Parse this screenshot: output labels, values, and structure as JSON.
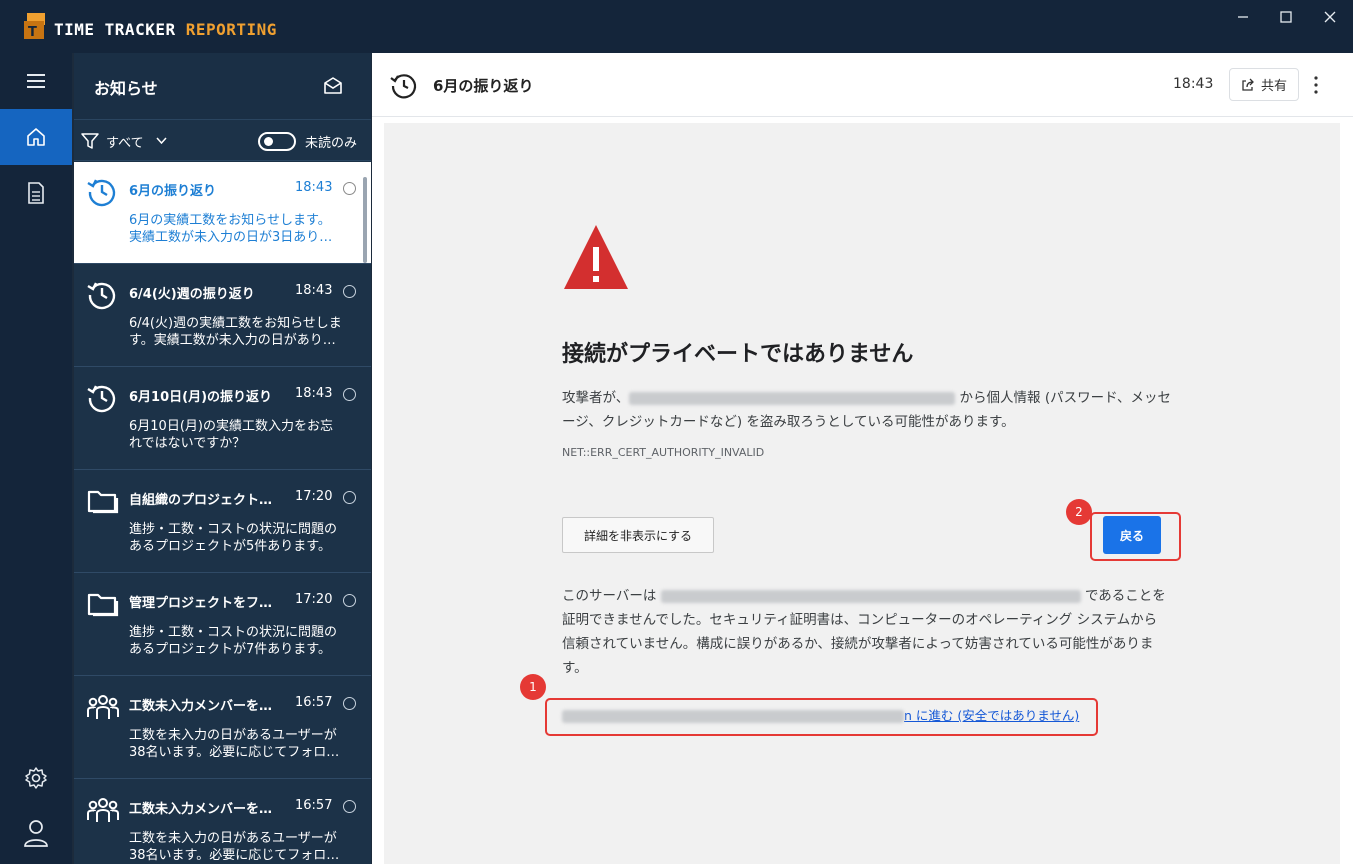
{
  "app": {
    "title_main": "TIME TRACKER ",
    "title_accent": "REPORTING",
    "accent_color": "#f0a030"
  },
  "window_controls": [
    "minimize-icon",
    "maximize-icon",
    "close-icon"
  ],
  "rail": {
    "items": [
      "menu-icon",
      "home-icon",
      "document-icon"
    ],
    "bottom": [
      "gear-icon",
      "user-icon"
    ],
    "active": "home-icon"
  },
  "panel": {
    "title": "お知らせ",
    "filter_label": "すべて",
    "unread_toggle_label": "未読のみ",
    "notifications": [
      {
        "icon": "history-icon",
        "title": "6月の振り返り",
        "time": "18:43",
        "line1": "6月の実績工数をお知らせします。",
        "line2": "実績工数が未入力の日が3日あり…",
        "selected": true
      },
      {
        "icon": "history-icon",
        "title": "6/4(火)週の振り返り",
        "time": "18:43",
        "line1": "6/4(火)週の実績工数をお知らせしま",
        "line2": "す。実績工数が未入力の日があり…",
        "selected": false
      },
      {
        "icon": "history-icon",
        "title": "6月10日(月)の振り返り",
        "time": "18:43",
        "line1": "6月10日(月)の実績工数入力をお忘",
        "line2": "れではないですか？",
        "selected": false
      },
      {
        "icon": "folder-icon",
        "title": "自組織のプロジェクト…",
        "time": "17:20",
        "line1": "進捗・工数・コストの状況に問題の",
        "line2": "あるプロジェクトが5件あります。",
        "selected": false
      },
      {
        "icon": "folder-icon",
        "title": "管理プロジェクトをフ…",
        "time": "17:20",
        "line1": "進捗・工数・コストの状況に問題の",
        "line2": "あるプロジェクトが7件あります。",
        "selected": false
      },
      {
        "icon": "group-icon",
        "title": "工数未入力メンバーを…",
        "time": "16:57",
        "line1": "工数を未入力の日があるユーザーが",
        "line2": "38名います。必要に応じてフォロ…",
        "selected": false
      },
      {
        "icon": "group-icon",
        "title": "工数未入力メンバーを…",
        "time": "16:57",
        "line1": "工数を未入力の日があるユーザーが",
        "line2": "38名います。必要に応じてフォロ…",
        "selected": false
      }
    ]
  },
  "content": {
    "title": "6月の振り返り",
    "time": "18:43",
    "share_label": "共有",
    "error": {
      "heading": "接続がプライベートではありません",
      "para_prefix": "攻撃者が、",
      "para_suffix": " から個人情報 (パスワード、メッセージ、クレジットカードなど) を盗み取ろうとしている可能性があります。",
      "code": "NET::ERR_CERT_AUTHORITY_INVALID",
      "details_button": "詳細を非表示にする",
      "back_button": "戻る",
      "server_prefix": "このサーバーは ",
      "server_suffix": " であることを証明できませんでした。セキュリティ証明書は、コンピューターのオペレーティング システムから信頼されていません。構成に誤りがあるか、接続が攻撃者によって妨害されている可能性があります。",
      "proceed_tail": "n に進む (安全ではありません)"
    },
    "annotations": {
      "badge_1": "1",
      "badge_2": "2",
      "highlight_color": "#e53935"
    }
  }
}
